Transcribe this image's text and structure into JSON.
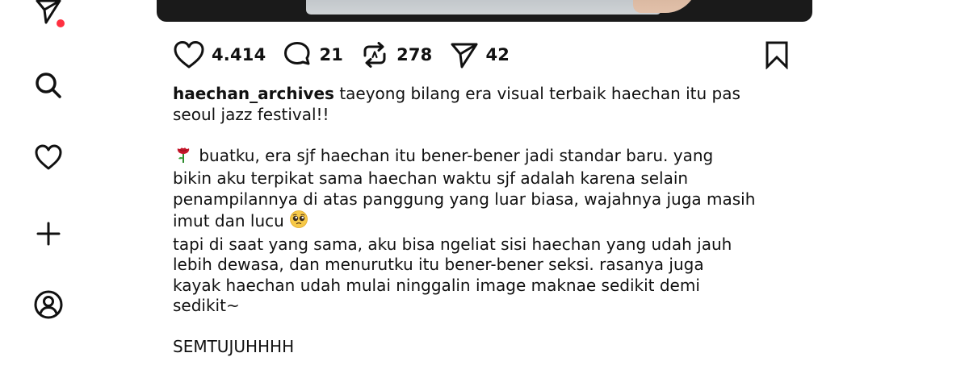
{
  "sidebar": {
    "items": [
      {
        "icon": "send-icon",
        "has_notification": true,
        "notification_color": "#ff3040"
      },
      {
        "icon": "search-icon"
      },
      {
        "icon": "heart-icon"
      },
      {
        "icon": "plus-icon"
      },
      {
        "icon": "profile-icon"
      }
    ]
  },
  "post": {
    "actions": {
      "likes": "4.414",
      "comments": "21",
      "reposts": "278",
      "shares": "42"
    },
    "caption": {
      "username": "haechan_archives",
      "line1": "taeyong bilang era visual terbaik haechan itu pas",
      "line1b": "seoul jazz festival!!",
      "para2_emoji": "rose",
      "para2": " buatku, era sjf haechan itu bener-bener jadi standar baru. yang\nbikin aku terpikat sama haechan waktu sjf adalah karena selain\npenampilannya di atas panggung yang luar biasa, wajahnya juga masih\nimut dan lucu ",
      "para2_end_emoji": "pleading-face",
      "para3": "tapi di saat yang sama, aku bisa ngeliat sisi haechan yang udah jauh\nlebih dewasa, dan menurutku itu bener-bener seksi. rasanya juga\nkayak haechan udah mulai ninggalin image maknae sedikit demi\nsedikit~",
      "para4": "SEMTUJUHHHH"
    }
  }
}
